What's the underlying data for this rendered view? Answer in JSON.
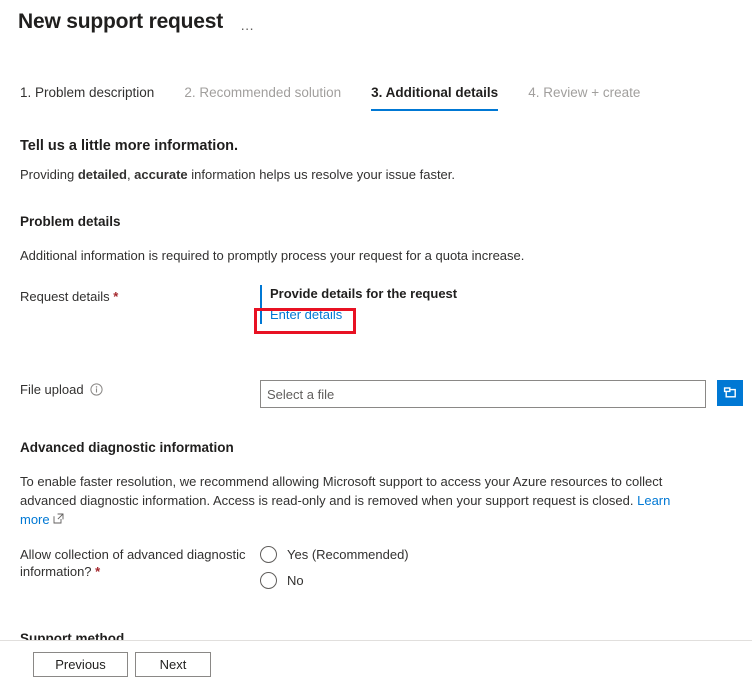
{
  "header": {
    "title": "New support request",
    "ellipsis": "…"
  },
  "tabs": [
    {
      "label": "1. Problem description",
      "state": "enabled"
    },
    {
      "label": "2. Recommended solution",
      "state": "disabled"
    },
    {
      "label": "3. Additional details",
      "state": "active"
    },
    {
      "label": "4. Review + create",
      "state": "disabled"
    }
  ],
  "intro": {
    "heading": "Tell us a little more information.",
    "sub_prefix": "Providing ",
    "sub_bold1": "detailed",
    "sub_mid": ", ",
    "sub_bold2": "accurate",
    "sub_suffix": " information helps us resolve your issue faster."
  },
  "problem_details": {
    "heading": "Problem details",
    "description": "Additional information is required to promptly process your request for a quota increase.",
    "request_details_label": "Request details",
    "required_marker": "*",
    "provide_details_title": "Provide details for the request",
    "enter_details_link": "Enter details"
  },
  "file_upload": {
    "label": "File upload",
    "info_icon": "info-icon",
    "placeholder": "Select a file",
    "value": "",
    "browse_icon": "folder-icon"
  },
  "advanced": {
    "heading": "Advanced diagnostic information",
    "paragraph": "To enable faster resolution, we recommend allowing Microsoft support to access your Azure resources to collect advanced diagnostic information. Access is read-only and is removed when your support request is closed. ",
    "learn_more": "Learn more",
    "external_icon": "external-link-icon",
    "question_label": "Allow collection of advanced diagnostic information?",
    "required_marker": "*",
    "options": [
      {
        "label": "Yes (Recommended)",
        "selected": false
      },
      {
        "label": "No",
        "selected": false
      }
    ]
  },
  "support_method": {
    "heading": "Support method"
  },
  "footer": {
    "previous": "Previous",
    "next": "Next"
  },
  "colors": {
    "accent": "#0078d4",
    "highlight": "#e81123",
    "required": "#a4262c",
    "disabled_text": "#a19f9d"
  }
}
